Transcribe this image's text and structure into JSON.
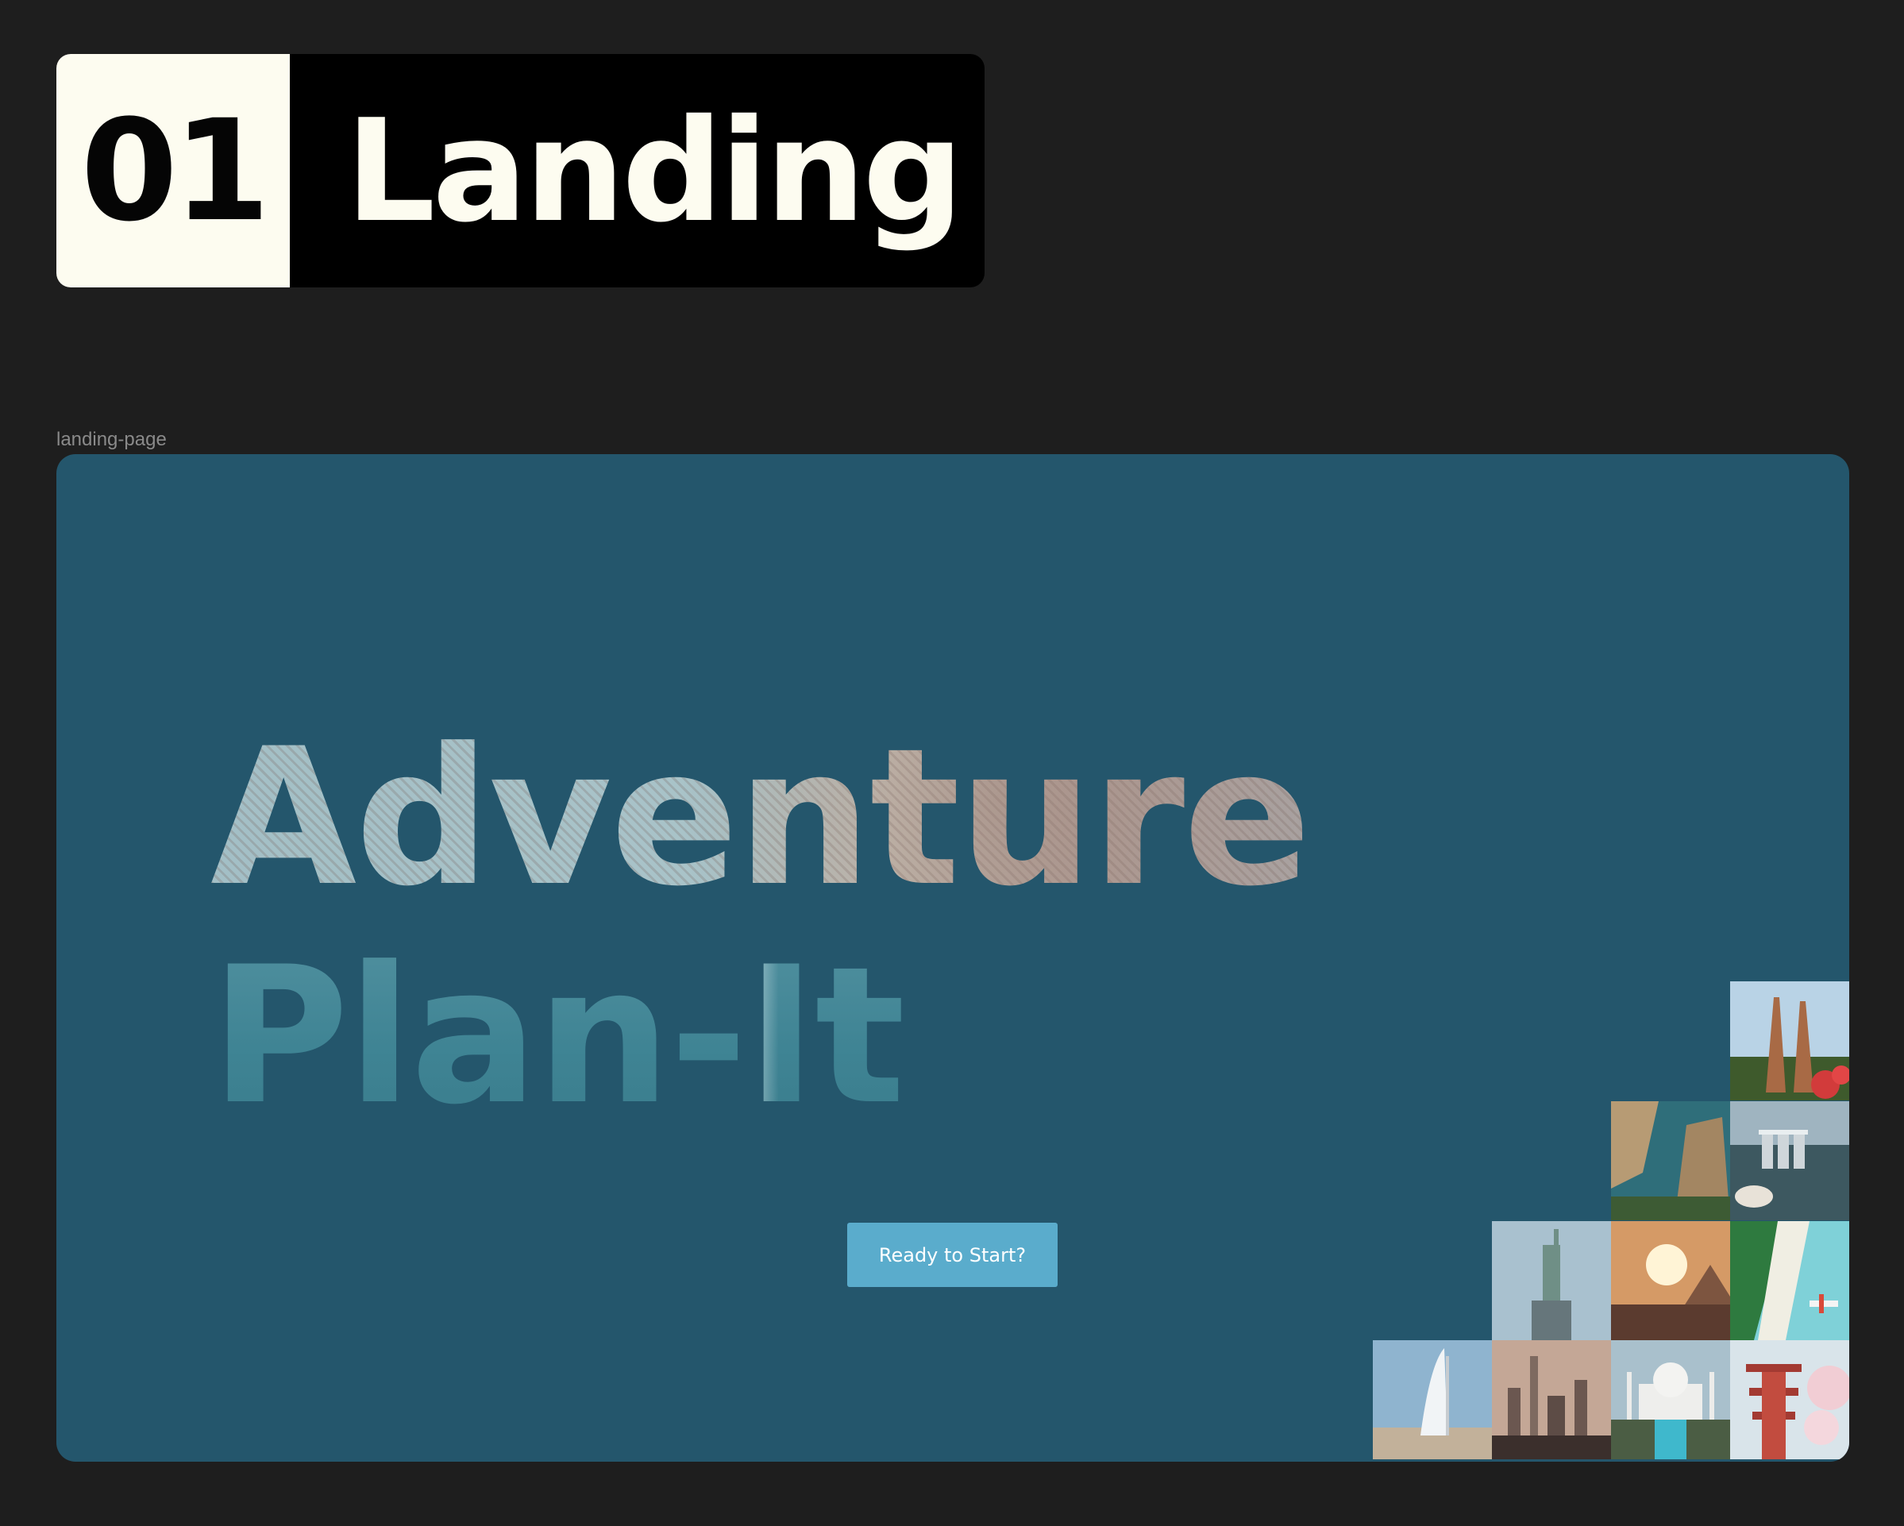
{
  "header": {
    "number": "01",
    "title": "Landing"
  },
  "frame": {
    "label": "landing-page"
  },
  "hero": {
    "line1": "Adventure",
    "line2": "Plan-It"
  },
  "cta": {
    "label": "Ready to Start?"
  },
  "colors": {
    "background": "#1e1e1e",
    "landing_bg": "#24566c",
    "button": "#5aaccc",
    "badge_light": "#fdfcf0",
    "badge_dark": "#000000"
  },
  "gallery": [
    {
      "name": "bali-gate-tile"
    },
    {
      "name": "cliff-beach-tile"
    },
    {
      "name": "singapore-bay-tile"
    },
    {
      "name": "statue-of-liberty-tile"
    },
    {
      "name": "pyramids-sunset-tile"
    },
    {
      "name": "maldives-seaplane-tile"
    },
    {
      "name": "burj-al-arab-tile"
    },
    {
      "name": "dubai-skyline-tile"
    },
    {
      "name": "taj-mahal-tile"
    },
    {
      "name": "japanese-pagoda-tile"
    }
  ]
}
